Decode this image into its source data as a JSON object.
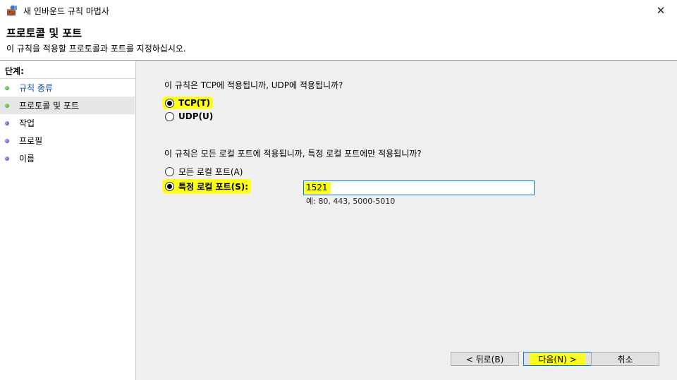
{
  "window": {
    "title": "새 인바운드 규칙 마법사",
    "close_glyph": "✕"
  },
  "header": {
    "title": "프로토콜 및 포트",
    "description": "이 규칙을 적용할 프로토콜과 포트를 지정하십시오."
  },
  "steps": {
    "heading": "단계:",
    "items": [
      {
        "label": "규칙 종류",
        "state": "done",
        "active": false
      },
      {
        "label": "프로토콜 및 포트",
        "state": "done",
        "active": true
      },
      {
        "label": "작업",
        "state": "todo",
        "active": false
      },
      {
        "label": "프로필",
        "state": "todo",
        "active": false
      },
      {
        "label": "이름",
        "state": "todo",
        "active": false
      }
    ]
  },
  "protocol": {
    "question": "이 규칙은 TCP에 적용됩니까, UDP에 적용됩니까?",
    "options": [
      {
        "label": "TCP(T)",
        "checked": true
      },
      {
        "label": "UDP(U)",
        "checked": false
      }
    ]
  },
  "ports": {
    "question": "이 규칙은 모든 로컬 포트에 적용됩니까, 특정 로컬 포트에만 적용됩니까?",
    "all_label": "모든 로컬 포트(A)",
    "specific_label": "특정 로컬 포트(S):",
    "value": "1521",
    "example": "예: 80, 443, 5000-5010"
  },
  "buttons": {
    "back": "< 뒤로(B)",
    "next": "다음(N) >",
    "cancel": "취소"
  },
  "colors": {
    "highlight": "#fdfd1e",
    "link": "#0a4ea8",
    "focus": "#0078d7"
  }
}
